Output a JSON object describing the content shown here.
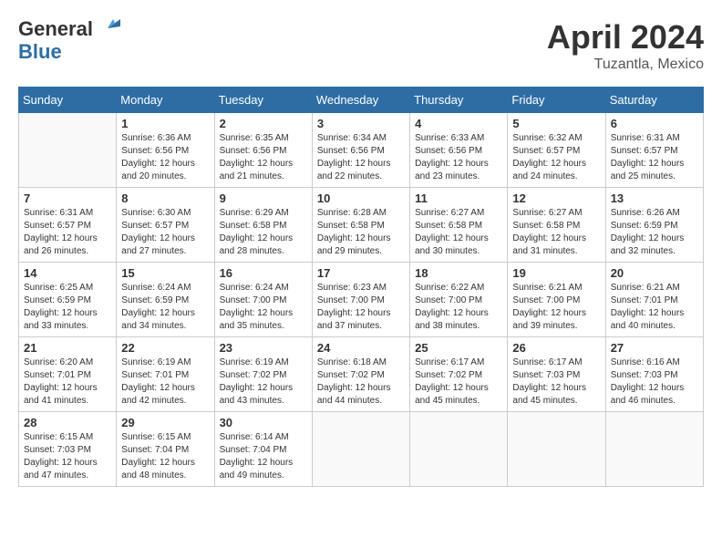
{
  "header": {
    "logo_line1": "General",
    "logo_line2": "Blue",
    "month": "April 2024",
    "location": "Tuzantla, Mexico"
  },
  "weekdays": [
    "Sunday",
    "Monday",
    "Tuesday",
    "Wednesday",
    "Thursday",
    "Friday",
    "Saturday"
  ],
  "weeks": [
    [
      {
        "day": "",
        "info": ""
      },
      {
        "day": "1",
        "info": "Sunrise: 6:36 AM\nSunset: 6:56 PM\nDaylight: 12 hours\nand 20 minutes."
      },
      {
        "day": "2",
        "info": "Sunrise: 6:35 AM\nSunset: 6:56 PM\nDaylight: 12 hours\nand 21 minutes."
      },
      {
        "day": "3",
        "info": "Sunrise: 6:34 AM\nSunset: 6:56 PM\nDaylight: 12 hours\nand 22 minutes."
      },
      {
        "day": "4",
        "info": "Sunrise: 6:33 AM\nSunset: 6:56 PM\nDaylight: 12 hours\nand 23 minutes."
      },
      {
        "day": "5",
        "info": "Sunrise: 6:32 AM\nSunset: 6:57 PM\nDaylight: 12 hours\nand 24 minutes."
      },
      {
        "day": "6",
        "info": "Sunrise: 6:31 AM\nSunset: 6:57 PM\nDaylight: 12 hours\nand 25 minutes."
      }
    ],
    [
      {
        "day": "7",
        "info": "Sunrise: 6:31 AM\nSunset: 6:57 PM\nDaylight: 12 hours\nand 26 minutes."
      },
      {
        "day": "8",
        "info": "Sunrise: 6:30 AM\nSunset: 6:57 PM\nDaylight: 12 hours\nand 27 minutes."
      },
      {
        "day": "9",
        "info": "Sunrise: 6:29 AM\nSunset: 6:58 PM\nDaylight: 12 hours\nand 28 minutes."
      },
      {
        "day": "10",
        "info": "Sunrise: 6:28 AM\nSunset: 6:58 PM\nDaylight: 12 hours\nand 29 minutes."
      },
      {
        "day": "11",
        "info": "Sunrise: 6:27 AM\nSunset: 6:58 PM\nDaylight: 12 hours\nand 30 minutes."
      },
      {
        "day": "12",
        "info": "Sunrise: 6:27 AM\nSunset: 6:58 PM\nDaylight: 12 hours\nand 31 minutes."
      },
      {
        "day": "13",
        "info": "Sunrise: 6:26 AM\nSunset: 6:59 PM\nDaylight: 12 hours\nand 32 minutes."
      }
    ],
    [
      {
        "day": "14",
        "info": "Sunrise: 6:25 AM\nSunset: 6:59 PM\nDaylight: 12 hours\nand 33 minutes."
      },
      {
        "day": "15",
        "info": "Sunrise: 6:24 AM\nSunset: 6:59 PM\nDaylight: 12 hours\nand 34 minutes."
      },
      {
        "day": "16",
        "info": "Sunrise: 6:24 AM\nSunset: 7:00 PM\nDaylight: 12 hours\nand 35 minutes."
      },
      {
        "day": "17",
        "info": "Sunrise: 6:23 AM\nSunset: 7:00 PM\nDaylight: 12 hours\nand 37 minutes."
      },
      {
        "day": "18",
        "info": "Sunrise: 6:22 AM\nSunset: 7:00 PM\nDaylight: 12 hours\nand 38 minutes."
      },
      {
        "day": "19",
        "info": "Sunrise: 6:21 AM\nSunset: 7:00 PM\nDaylight: 12 hours\nand 39 minutes."
      },
      {
        "day": "20",
        "info": "Sunrise: 6:21 AM\nSunset: 7:01 PM\nDaylight: 12 hours\nand 40 minutes."
      }
    ],
    [
      {
        "day": "21",
        "info": "Sunrise: 6:20 AM\nSunset: 7:01 PM\nDaylight: 12 hours\nand 41 minutes."
      },
      {
        "day": "22",
        "info": "Sunrise: 6:19 AM\nSunset: 7:01 PM\nDaylight: 12 hours\nand 42 minutes."
      },
      {
        "day": "23",
        "info": "Sunrise: 6:19 AM\nSunset: 7:02 PM\nDaylight: 12 hours\nand 43 minutes."
      },
      {
        "day": "24",
        "info": "Sunrise: 6:18 AM\nSunset: 7:02 PM\nDaylight: 12 hours\nand 44 minutes."
      },
      {
        "day": "25",
        "info": "Sunrise: 6:17 AM\nSunset: 7:02 PM\nDaylight: 12 hours\nand 45 minutes."
      },
      {
        "day": "26",
        "info": "Sunrise: 6:17 AM\nSunset: 7:03 PM\nDaylight: 12 hours\nand 45 minutes."
      },
      {
        "day": "27",
        "info": "Sunrise: 6:16 AM\nSunset: 7:03 PM\nDaylight: 12 hours\nand 46 minutes."
      }
    ],
    [
      {
        "day": "28",
        "info": "Sunrise: 6:15 AM\nSunset: 7:03 PM\nDaylight: 12 hours\nand 47 minutes."
      },
      {
        "day": "29",
        "info": "Sunrise: 6:15 AM\nSunset: 7:04 PM\nDaylight: 12 hours\nand 48 minutes."
      },
      {
        "day": "30",
        "info": "Sunrise: 6:14 AM\nSunset: 7:04 PM\nDaylight: 12 hours\nand 49 minutes."
      },
      {
        "day": "",
        "info": ""
      },
      {
        "day": "",
        "info": ""
      },
      {
        "day": "",
        "info": ""
      },
      {
        "day": "",
        "info": ""
      }
    ]
  ]
}
